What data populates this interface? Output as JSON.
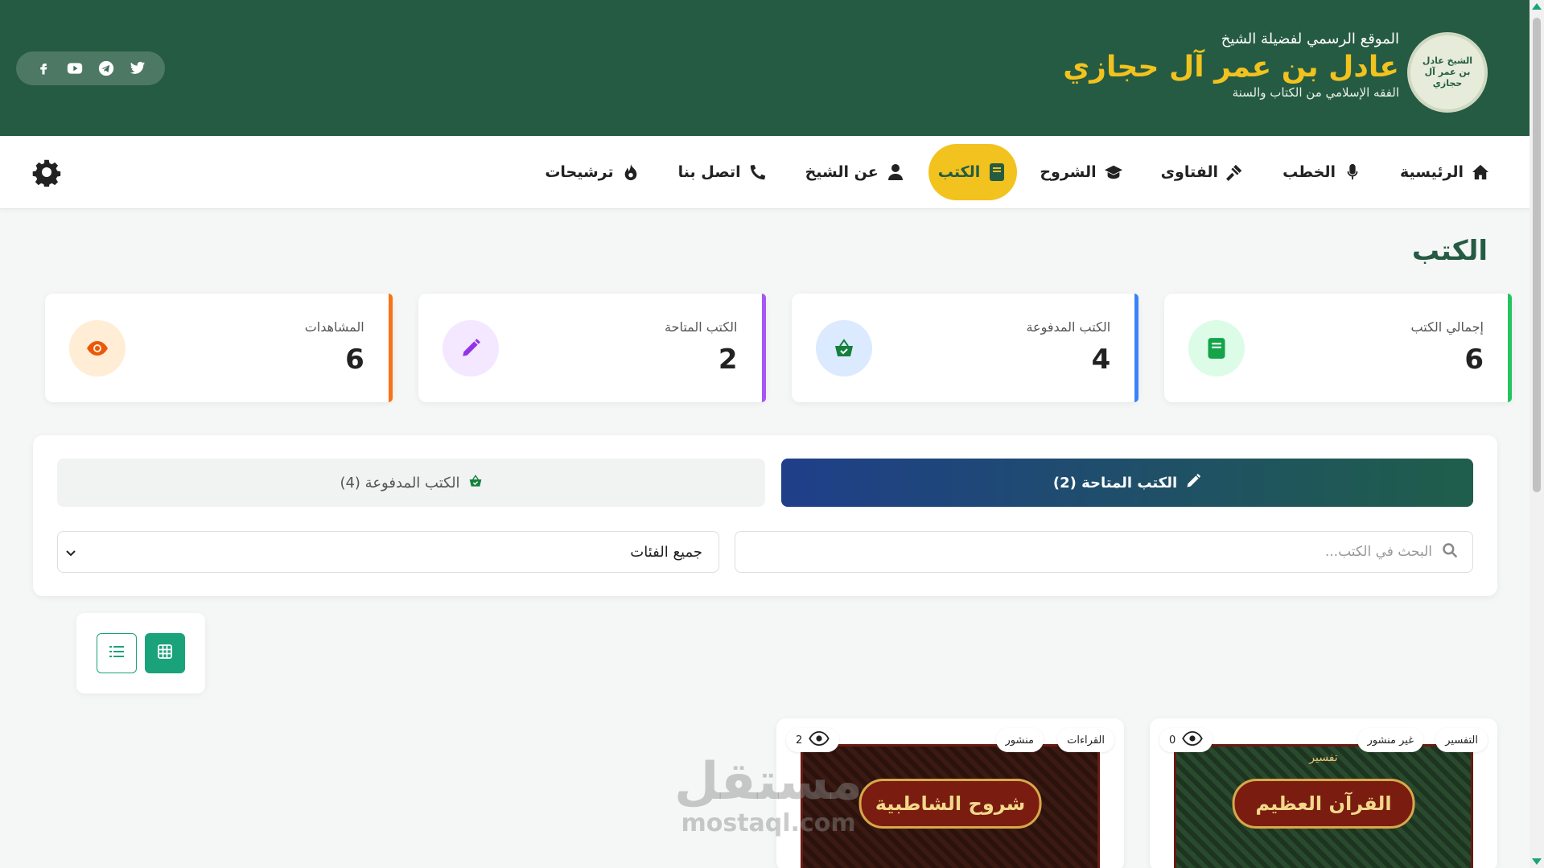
{
  "header": {
    "pre_title": "الموقع الرسمي لفضيلة الشيخ",
    "name": "عادل بن عمر آل حجازي",
    "tagline": "الفقه الإسلامي من الكتاب والسنة",
    "logo_text": "الشيخ عادل بن عمر آل حجازي",
    "social": [
      "facebook-icon",
      "youtube-icon",
      "telegram-icon",
      "twitter-icon"
    ]
  },
  "nav": {
    "items": [
      {
        "label": "الرئيسية",
        "icon": "home-icon"
      },
      {
        "label": "الخطب",
        "icon": "microphone-icon"
      },
      {
        "label": "الفتاوى",
        "icon": "gavel-icon"
      },
      {
        "label": "الشروح",
        "icon": "graduation-cap-icon"
      },
      {
        "label": "الكتب",
        "icon": "book-icon",
        "active": true
      },
      {
        "label": "عن الشيخ",
        "icon": "user-icon"
      },
      {
        "label": "اتصل بنا",
        "icon": "phone-icon"
      },
      {
        "label": "ترشيحات",
        "icon": "fire-icon"
      }
    ]
  },
  "page": {
    "title": "الكتب"
  },
  "stats": [
    {
      "label": "إجمالي الكتب",
      "value": "6",
      "color": "#22c55e",
      "icon": "book-icon"
    },
    {
      "label": "الكتب المدفوعة",
      "value": "4",
      "color": "#3b82f6",
      "icon": "shopping-basket-icon"
    },
    {
      "label": "الكتب المتاحة",
      "value": "2",
      "color": "#a855f7",
      "icon": "pen-icon"
    },
    {
      "label": "المشاهدات",
      "value": "6",
      "color": "#f97316",
      "icon": "eye-icon"
    }
  ],
  "tabs": {
    "available": "الكتب المتاحة (2)",
    "paid": "الكتب المدفوعة (4)"
  },
  "filters": {
    "search_placeholder": "البحث في الكتب...",
    "category_selected": "جميع الفئات"
  },
  "books": [
    {
      "views": "0",
      "status": "غير منشور",
      "category": "التفسير",
      "cover_pre": "تفسير",
      "cover_title": "القرآن العظيم"
    },
    {
      "views": "2",
      "status": "منشور",
      "category": "القراءات",
      "cover_pre": "",
      "cover_title": "شروح الشاطبية"
    }
  ],
  "watermark": {
    "ar": "مستقل",
    "en": "mostaql.com"
  }
}
